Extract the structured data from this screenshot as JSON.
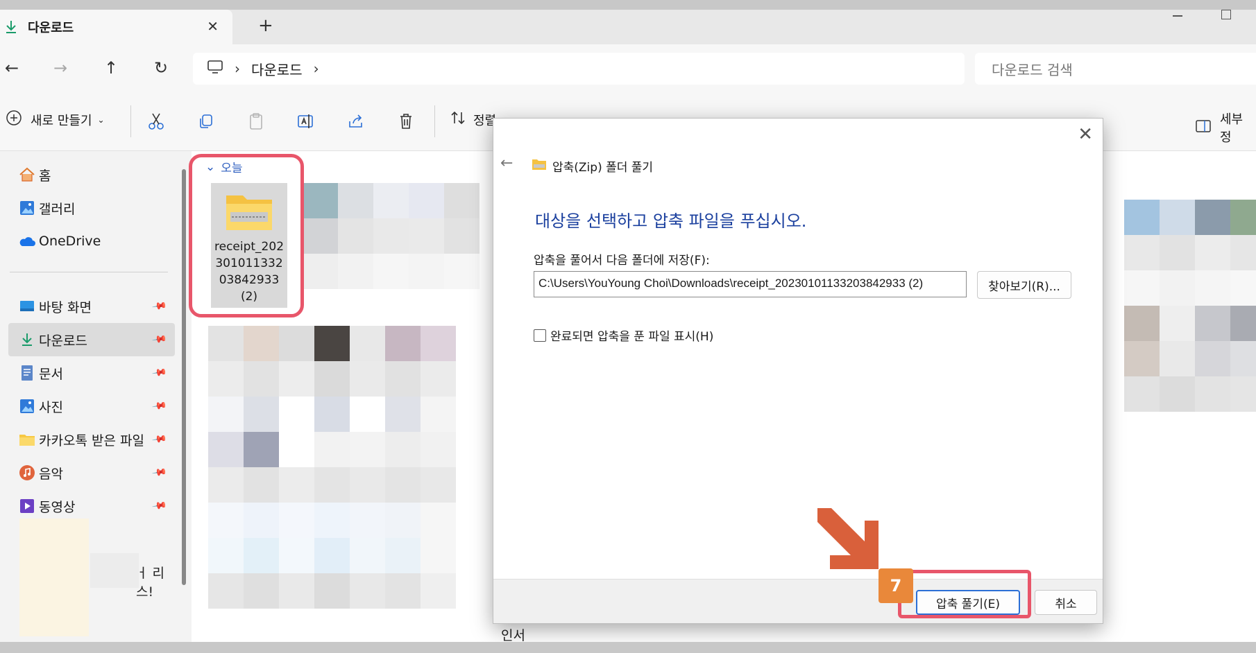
{
  "tab": {
    "title": "다운로드",
    "close": "✕",
    "new_tab": "+"
  },
  "address": {
    "segment": "다운로드",
    "search_placeholder": "다운로드 검색"
  },
  "toolbar": {
    "new_label": "새로 만들기",
    "sort_label": "정렬",
    "details_label": "세부 정"
  },
  "sidebar": {
    "items": [
      {
        "label": "홈"
      },
      {
        "label": "갤러리"
      },
      {
        "label": "OneDrive"
      },
      {
        "label": "바탕 화면"
      },
      {
        "label": "다운로드"
      },
      {
        "label": "문서"
      },
      {
        "label": "사진"
      },
      {
        "label": "카카오톡 받은 파일"
      },
      {
        "label": "음악"
      },
      {
        "label": "동영상"
      }
    ],
    "partial_text": "ㅓ 리스!"
  },
  "content": {
    "group_header": "오늘",
    "file_name": "receipt_20230101133203842933 (2)",
    "bottom_text": "인서"
  },
  "dialog": {
    "title": "압축(Zip) 폴더 풀기",
    "heading": "대상을 선택하고 압축 파일을 푸십시오.",
    "path_label": "압축을 풀어서 다음 폴더에 저장(F):",
    "path_value": "C:\\Users\\YouYoung Choi\\Downloads\\receipt_20230101133203842933 (2)",
    "browse_label": "찾아보기(R)...",
    "checkbox_label": "완료되면 압축을 푼 파일 표시(H)",
    "checkbox_checked": false,
    "extract_label": "압축 풀기(E)",
    "cancel_label": "취소"
  },
  "annotation": {
    "step": "7",
    "accent": "#e8566a",
    "arrow_color": "#d9603b"
  }
}
